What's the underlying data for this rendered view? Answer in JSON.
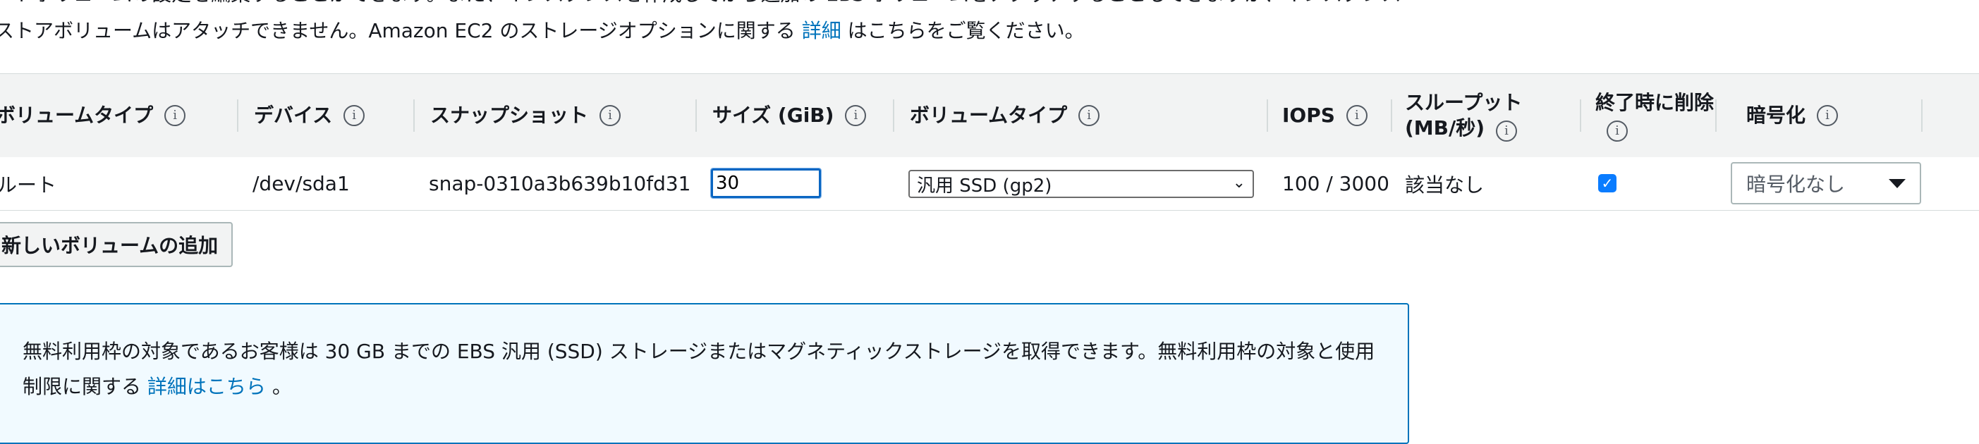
{
  "intro": {
    "line1": "ートボリュームの設定を編集することができます。また、インスタンスを作成してから追加の EBS ボリュームをアタッチすることもできますが、インスタンス",
    "line2_prefix": "ストアボリュームはアタッチできません。Amazon EC2 のストレージオプションに関する ",
    "line2_link": "詳細",
    "line2_suffix": " はこちらをご覧ください。"
  },
  "table": {
    "headers": {
      "volume_type_1": "ボリュームタイプ",
      "device": "デバイス",
      "snapshot": "スナップショット",
      "size": "サイズ (GiB)",
      "volume_type_2": "ボリュームタイプ",
      "iops": "IOPS",
      "throughput": "スループット (MB/秒)",
      "delete_on_termination": "終了時に削除",
      "encryption": "暗号化"
    },
    "info_glyph": "i",
    "row": {
      "volume_type": "ルート",
      "device": "/dev/sda1",
      "snapshot": "snap-0310a3b639b10fd31",
      "size": "30",
      "volume_type_select": "汎用 SSD (gp2)",
      "iops": "100 / 3000",
      "throughput": "該当なし",
      "delete_on_termination": true,
      "encryption": "暗号化なし"
    }
  },
  "add_volume_button": "新しいボリュームの追加",
  "notice": {
    "text_prefix": "無料利用枠の対象であるお客様は 30 GB までの EBS 汎用 (SSD) ストレージまたはマグネティックストレージを取得できます。無料利用枠の対象と使用制限に関する ",
    "link": "詳細はこちら",
    "text_suffix": " 。"
  },
  "colors": {
    "link": "#0073bb",
    "header_bg": "#f2f3f3",
    "notice_bg": "#f1faff",
    "notice_border": "#0073bb",
    "checkbox": "#0a7cff"
  },
  "icons": {
    "info": "info-circle-icon",
    "check": "checkmark-icon",
    "dropdown": "chevron-down-icon",
    "caret": "caret-down-icon"
  }
}
